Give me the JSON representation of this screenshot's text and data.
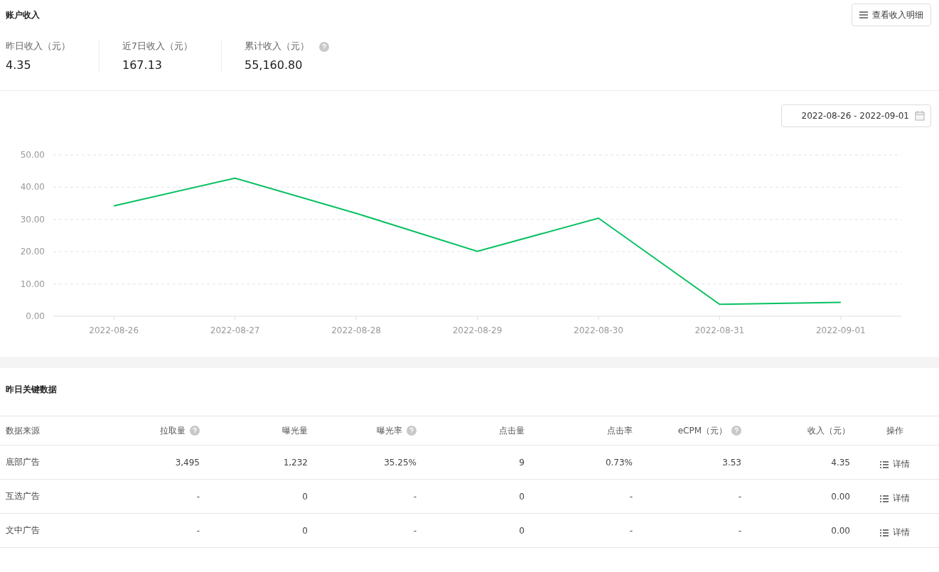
{
  "account_income": {
    "title": "账户收入",
    "detail_button": "查看收入明细",
    "stats": [
      {
        "label": "昨日收入（元）",
        "value": "4.35",
        "help": false
      },
      {
        "label": "近7日收入（元）",
        "value": "167.13",
        "help": false
      },
      {
        "label": "累计收入（元）",
        "value": "55,160.80",
        "help": true
      }
    ]
  },
  "trend": {
    "date_range": "2022-08-26 - 2022-09-01",
    "chart_data": {
      "type": "line",
      "categories": [
        "2022-08-26",
        "2022-08-27",
        "2022-08-28",
        "2022-08-29",
        "2022-08-30",
        "2022-08-31",
        "2022-09-01"
      ],
      "grid": true,
      "series": [
        {
          "color": "#07c160",
          "values": [
            34.2,
            42.8,
            31.9,
            20.1,
            30.4,
            3.7,
            4.3
          ]
        }
      ],
      "ylim": [
        0,
        50
      ],
      "yticks": [
        {
          "value": 0,
          "label": "0.00"
        },
        {
          "value": 10,
          "label": "10.00"
        },
        {
          "value": 20,
          "label": "20.00"
        },
        {
          "value": 30,
          "label": "30.00"
        },
        {
          "value": 40,
          "label": "40.00"
        },
        {
          "value": 50,
          "label": "50.00"
        }
      ]
    }
  },
  "key_data": {
    "title": "昨日关键数据",
    "columns": [
      {
        "label": "数据来源",
        "help": false
      },
      {
        "label": "拉取量",
        "help": true
      },
      {
        "label": "曝光量",
        "help": false
      },
      {
        "label": "曝光率",
        "help": true
      },
      {
        "label": "点击量",
        "help": false
      },
      {
        "label": "点击率",
        "help": false
      },
      {
        "label": "eCPM（元）",
        "help": true
      },
      {
        "label": "收入（元）",
        "help": false
      },
      {
        "label": "操作",
        "help": false
      }
    ],
    "rows": [
      {
        "cells": [
          "底部广告",
          "3,495",
          "1,232",
          "35.25%",
          "9",
          "0.73%",
          "3.53",
          "4.35"
        ],
        "action": "详情"
      },
      {
        "cells": [
          "互选广告",
          "-",
          "0",
          "-",
          "0",
          "-",
          "-",
          "0.00"
        ],
        "action": "详情"
      },
      {
        "cells": [
          "文中广告",
          "-",
          "0",
          "-",
          "0",
          "-",
          "-",
          "0.00"
        ],
        "action": "详情"
      }
    ]
  }
}
